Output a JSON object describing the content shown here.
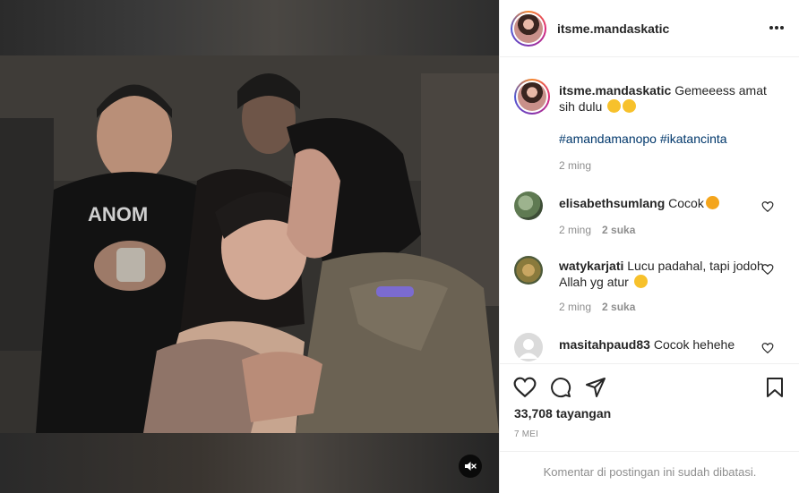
{
  "post": {
    "author": "itsme.mandaskatic",
    "caption": {
      "username": "itsme.mandaskatic",
      "text": "Gemeeess amat sih dulu",
      "hashtags": "#amandamanopo #ikatancinta",
      "time": "2 ming"
    },
    "views_count": "33,708",
    "views_label": "tayangan",
    "date": "7 MEI",
    "comments_disabled": "Komentar di postingan ini sudah dibatasi."
  },
  "comments": [
    {
      "username": "elisabethsumlang",
      "text": "Cocok",
      "emoji": "heart-eyes-emoji",
      "time": "2 ming",
      "likes": "2 suka"
    },
    {
      "username": "watykarjati",
      "text": "Lucu padahal, tapi jodoh Allah yg atur",
      "emoji": "grinning-sweat-emoji",
      "time": "2 ming",
      "likes": "2 suka"
    },
    {
      "username": "masitahpaud83",
      "text": "Cocok hehehe"
    }
  ],
  "colors": {
    "text": "#262626",
    "secondary": "#8e8e8e",
    "hashtag": "#00376b",
    "border": "#efefef"
  },
  "icons": [
    "more-options-icon",
    "like-icon",
    "comment-icon",
    "share-icon",
    "save-icon",
    "mute-icon",
    "heart-small-icon"
  ]
}
